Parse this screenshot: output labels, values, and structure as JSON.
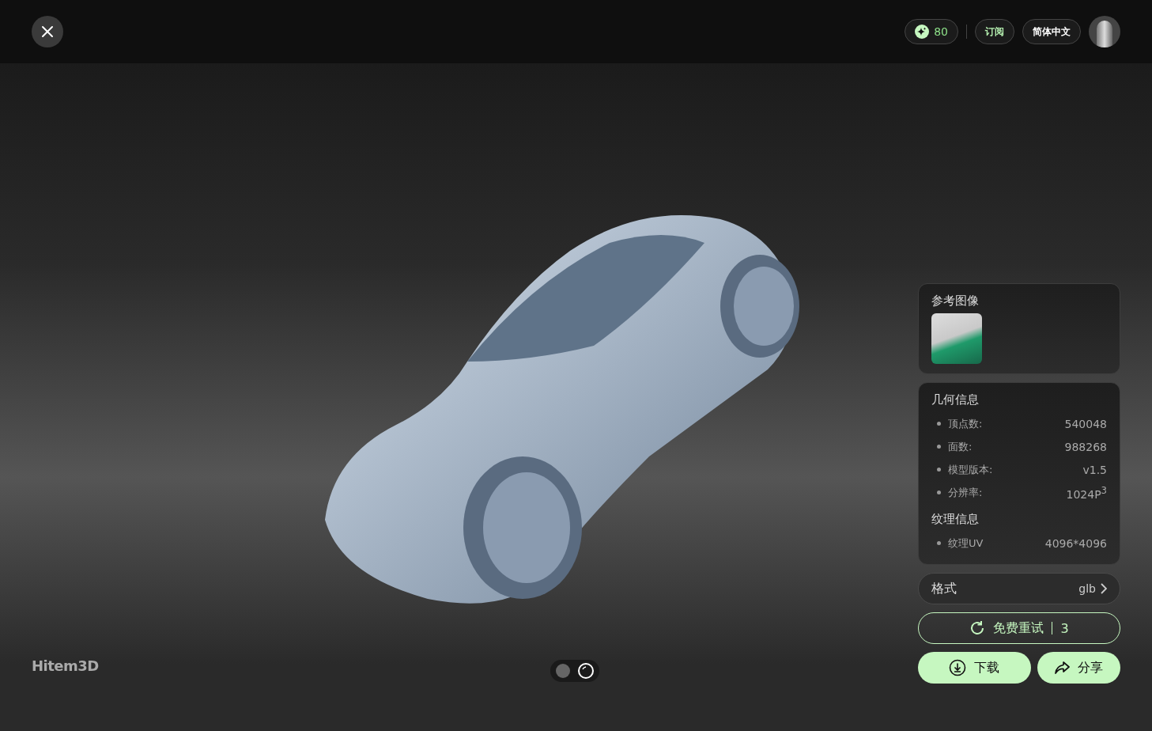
{
  "top_bar": {
    "credits": "80",
    "subscribe": "订阅",
    "language": "简体中文"
  },
  "reference": {
    "title": "参考图像"
  },
  "geometry": {
    "title": "几何信息",
    "items": [
      {
        "label": "顶点数:",
        "value": "540048"
      },
      {
        "label": "面数:",
        "value": "988268"
      },
      {
        "label": "模型版本:",
        "value": "v1.5"
      },
      {
        "label": "分辨率:",
        "value": "1024P$^{3}$"
      }
    ]
  },
  "texture": {
    "title": "纹理信息",
    "items": [
      {
        "label": "纹理UV",
        "value": "4096*4096"
      }
    ]
  },
  "format": {
    "label": "格式",
    "value": "glb"
  },
  "retry": {
    "label": "免费重试",
    "count": "3"
  },
  "download": "下载",
  "share": "分享",
  "logo": "Hitem3D",
  "view_modes": [
    {
      "kind": "solid",
      "selected": false
    },
    {
      "kind": "outline",
      "selected": true
    }
  ]
}
